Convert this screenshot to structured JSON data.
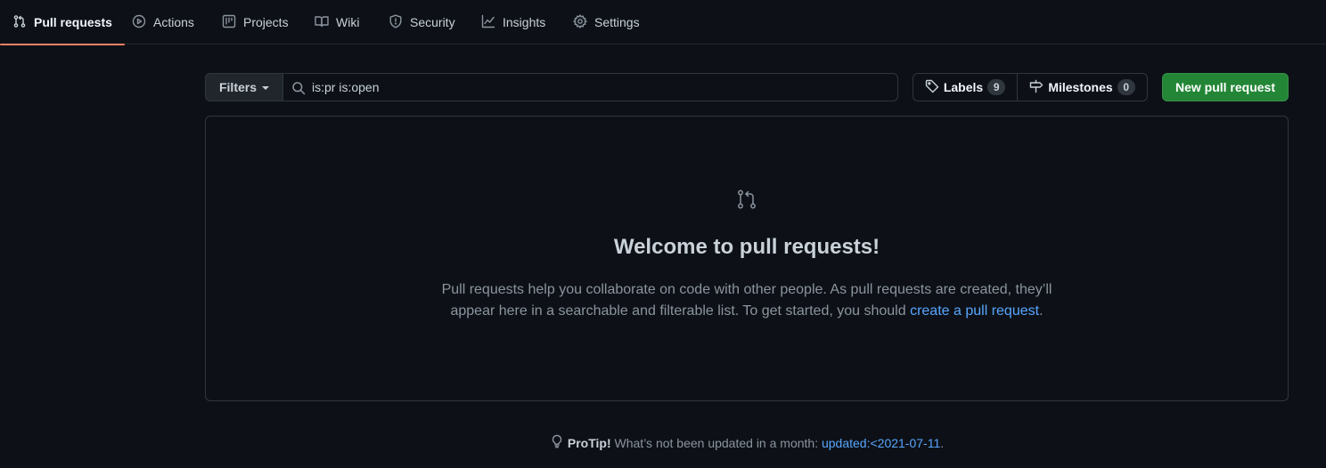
{
  "nav": {
    "tabs": [
      {
        "label": "Pull requests",
        "icon": "git-pull-request-icon",
        "active": true
      },
      {
        "label": "Actions",
        "icon": "play-icon"
      },
      {
        "label": "Projects",
        "icon": "project-icon"
      },
      {
        "label": "Wiki",
        "icon": "book-icon"
      },
      {
        "label": "Security",
        "icon": "shield-icon"
      },
      {
        "label": "Insights",
        "icon": "graph-icon"
      },
      {
        "label": "Settings",
        "icon": "gear-icon"
      }
    ]
  },
  "toolbar": {
    "filters_label": "Filters",
    "search_value": "is:pr is:open",
    "labels_label": "Labels",
    "labels_count": "9",
    "milestones_label": "Milestones",
    "milestones_count": "0",
    "new_pr_label": "New pull request"
  },
  "blankslate": {
    "icon": "git-pull-request-icon",
    "title": "Welcome to pull requests!",
    "description_before": "Pull requests help you collaborate on code with other people. As pull requests are created, they’ll appear here in a searchable and filterable list. To get started, you should ",
    "link_text": "create a pull request",
    "description_after": "."
  },
  "protip": {
    "icon": "light-bulb-icon",
    "label": "ProTip!",
    "text": " What’s not been updated in a month: ",
    "link_text": "updated:<2021-07-11",
    "after": "."
  },
  "colors": {
    "background": "#0d1117",
    "accent_underline": "#f78166",
    "primary_button": "#238636",
    "link": "#58a6ff"
  }
}
